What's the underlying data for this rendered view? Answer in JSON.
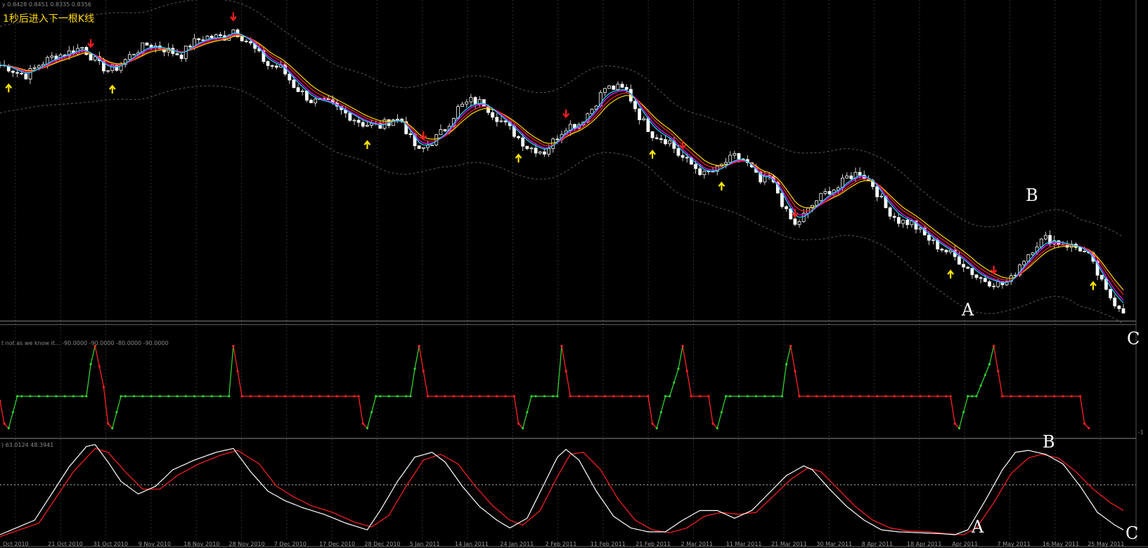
{
  "banner": "1秒后进入下一根K线",
  "price_header": "y  0.8428 0.8451 0.8335 0.8356",
  "indicator1_header": "t not as we know it...  -90.0000 -90.0000 -80.0000 -90.0000",
  "indicator2_header": ")  63.0124  48.3941",
  "panel2_scale_top": "",
  "panel2_scale_bottom": "-1",
  "letters": {
    "main_A": "A",
    "main_B": "B",
    "main_C": "C",
    "sub_A": "A",
    "sub_B": "B",
    "sub_C": "C"
  },
  "colors": {
    "background": "#000000",
    "bull_candle": "#ffffff",
    "bear_candle": "#ffffff",
    "ma_fast": "#ff00ff",
    "ma_medium": "#00e5ff",
    "ma_slow": "#ffd800",
    "ma_red": "#ff2020",
    "arrow_down": "#ff1e1e",
    "arrow_up": "#ffe600",
    "envelope": "#5a5a5a",
    "osc_up": "#30d030",
    "osc_down": "#ff2020",
    "stoch_main": "#ffffff",
    "stoch_signal": "#ff2020"
  },
  "chart_data": {
    "type": "candlestick",
    "x_ticks": [
      "Oct 2010",
      "21 Oct 2010",
      "31 Oct 2010",
      "9 Nov 2010",
      "18 Nov 2010",
      "28 Nov 2010",
      "7 Dec 2010",
      "17 Dec 2010",
      "28 Dec 2010",
      "5 Jan 2011",
      "14 Jan 2011",
      "24 Jan 2011",
      "2 Feb 2011",
      "11 Feb 2011",
      "21 Feb 2011",
      "2 Mar 2011",
      "11 Mar 2011",
      "21 Mar 2011",
      "30 Mar 2011",
      "8 Apr 2011",
      "18 Apr 2011",
      "Apr 2011",
      "7 May 2011",
      "16 May 2011",
      "25 May 2011"
    ],
    "price_anchors": [
      [
        0,
        0.8
      ],
      [
        2,
        0.79
      ],
      [
        4,
        0.77
      ],
      [
        6,
        0.76
      ],
      [
        9,
        0.8
      ],
      [
        12,
        0.83
      ],
      [
        16,
        0.85
      ],
      [
        19,
        0.87
      ],
      [
        21,
        0.835
      ],
      [
        23,
        0.8
      ],
      [
        25,
        0.78
      ],
      [
        27,
        0.79
      ],
      [
        31,
        0.85
      ],
      [
        34,
        0.88
      ],
      [
        37,
        0.87
      ],
      [
        40,
        0.85
      ],
      [
        42,
        0.84
      ],
      [
        44,
        0.88
      ],
      [
        46,
        0.9
      ],
      [
        48,
        0.91
      ],
      [
        52,
        0.91
      ],
      [
        54,
        0.94
      ],
      [
        58,
        0.88
      ],
      [
        62,
        0.8
      ],
      [
        65,
        0.79
      ],
      [
        68,
        0.72
      ],
      [
        72,
        0.66
      ],
      [
        76,
        0.65
      ],
      [
        80,
        0.61
      ],
      [
        84,
        0.57
      ],
      [
        88,
        0.56
      ],
      [
        91,
        0.59
      ],
      [
        93,
        0.58
      ],
      [
        95,
        0.51
      ],
      [
        97,
        0.46
      ],
      [
        100,
        0.5
      ],
      [
        103,
        0.55
      ],
      [
        106,
        0.63
      ],
      [
        109,
        0.66
      ],
      [
        112,
        0.65
      ],
      [
        114,
        0.61
      ],
      [
        118,
        0.55
      ],
      [
        122,
        0.48
      ],
      [
        126,
        0.46
      ],
      [
        128,
        0.5
      ],
      [
        131,
        0.56
      ],
      [
        134,
        0.57
      ],
      [
        137,
        0.63
      ],
      [
        140,
        0.71
      ],
      [
        143,
        0.71
      ],
      [
        145,
        0.7
      ],
      [
        148,
        0.6
      ],
      [
        151,
        0.53
      ],
      [
        155,
        0.5
      ],
      [
        157,
        0.45
      ],
      [
        160,
        0.41
      ],
      [
        163,
        0.37
      ],
      [
        166,
        0.39
      ],
      [
        168,
        0.42
      ],
      [
        170,
        0.44
      ],
      [
        172,
        0.43
      ],
      [
        174,
        0.39
      ],
      [
        176,
        0.34
      ],
      [
        178,
        0.36
      ],
      [
        180,
        0.3
      ],
      [
        182,
        0.22
      ],
      [
        184,
        0.17
      ],
      [
        186,
        0.21
      ],
      [
        189,
        0.27
      ],
      [
        192,
        0.31
      ],
      [
        194,
        0.32
      ],
      [
        196,
        0.36
      ],
      [
        199,
        0.38
      ],
      [
        202,
        0.33
      ],
      [
        205,
        0.24
      ],
      [
        208,
        0.19
      ],
      [
        211,
        0.18
      ],
      [
        214,
        0.13
      ],
      [
        217,
        0.09
      ],
      [
        220,
        0.06
      ],
      [
        223,
        0.02
      ],
      [
        226,
        -0.03
      ],
      [
        229,
        -0.05
      ],
      [
        232,
        -0.06
      ],
      [
        234,
        -0.04
      ],
      [
        236,
        0.02
      ],
      [
        238,
        0.06
      ],
      [
        240,
        0.1
      ],
      [
        242,
        0.12
      ],
      [
        244,
        0.11
      ],
      [
        246,
        0.1
      ],
      [
        248,
        0.09
      ],
      [
        250,
        0.08
      ],
      [
        252,
        0.05
      ],
      [
        254,
        -0.02
      ],
      [
        256,
        -0.09
      ],
      [
        258,
        -0.13
      ],
      [
        260,
        -0.16
      ]
    ],
    "bar_count": 261,
    "price_min": -0.19,
    "price_max": 1.0,
    "down_arrows": [
      21,
      54,
      98,
      131,
      158,
      184,
      230
    ],
    "up_arrows": [
      2,
      26,
      85,
      120,
      151,
      167,
      220,
      253
    ],
    "osc_bars": [
      [
        0,
        -30
      ],
      [
        1,
        -80
      ],
      [
        2,
        -90
      ],
      [
        4,
        -20
      ],
      [
        5,
        -20
      ],
      [
        20,
        -20
      ],
      [
        21,
        50
      ],
      [
        22,
        90
      ],
      [
        24,
        0
      ],
      [
        25,
        -80
      ],
      [
        26,
        -90
      ],
      [
        28,
        -20
      ],
      [
        29,
        -20
      ],
      [
        53,
        -20
      ],
      [
        54,
        90
      ],
      [
        56,
        -20
      ],
      [
        83,
        -20
      ],
      [
        84,
        -80
      ],
      [
        85,
        -90
      ],
      [
        87,
        -20
      ],
      [
        88,
        -20
      ],
      [
        95,
        -20
      ],
      [
        96,
        40
      ],
      [
        97,
        90
      ],
      [
        99,
        -20
      ],
      [
        119,
        -20
      ],
      [
        120,
        -80
      ],
      [
        121,
        -90
      ],
      [
        123,
        -20
      ],
      [
        124,
        -20
      ],
      [
        129,
        -20
      ],
      [
        130,
        90
      ],
      [
        132,
        -20
      ],
      [
        150,
        -20
      ],
      [
        151,
        -80
      ],
      [
        152,
        -90
      ],
      [
        154,
        -20
      ],
      [
        155,
        -20
      ],
      [
        157,
        40
      ],
      [
        158,
        90
      ],
      [
        160,
        -20
      ],
      [
        164,
        -20
      ],
      [
        165,
        -80
      ],
      [
        166,
        -90
      ],
      [
        168,
        -20
      ],
      [
        169,
        -20
      ],
      [
        181,
        -20
      ],
      [
        182,
        50
      ],
      [
        183,
        90
      ],
      [
        185,
        -20
      ],
      [
        220,
        -20
      ],
      [
        221,
        -80
      ],
      [
        222,
        -90
      ],
      [
        224,
        -20
      ],
      [
        225,
        -20
      ],
      [
        226,
        -20
      ],
      [
        229,
        50
      ],
      [
        230,
        90
      ],
      [
        232,
        -20
      ],
      [
        250,
        -20
      ],
      [
        251,
        -80
      ],
      [
        252,
        -90
      ]
    ],
    "stoch_main": [
      [
        0,
        5
      ],
      [
        8,
        20
      ],
      [
        16,
        75
      ],
      [
        20,
        96
      ],
      [
        22,
        98
      ],
      [
        25,
        80
      ],
      [
        28,
        60
      ],
      [
        32,
        47
      ],
      [
        36,
        55
      ],
      [
        40,
        72
      ],
      [
        45,
        82
      ],
      [
        50,
        90
      ],
      [
        54,
        94
      ],
      [
        58,
        70
      ],
      [
        62,
        50
      ],
      [
        66,
        40
      ],
      [
        70,
        33
      ],
      [
        75,
        26
      ],
      [
        80,
        17
      ],
      [
        85,
        10
      ],
      [
        88,
        30
      ],
      [
        92,
        60
      ],
      [
        96,
        85
      ],
      [
        100,
        90
      ],
      [
        103,
        80
      ],
      [
        107,
        55
      ],
      [
        111,
        34
      ],
      [
        115,
        20
      ],
      [
        118,
        12
      ],
      [
        122,
        22
      ],
      [
        126,
        58
      ],
      [
        129,
        85
      ],
      [
        131,
        93
      ],
      [
        134,
        82
      ],
      [
        138,
        50
      ],
      [
        142,
        24
      ],
      [
        146,
        12
      ],
      [
        150,
        8
      ],
      [
        154,
        8
      ],
      [
        158,
        20
      ],
      [
        162,
        30
      ],
      [
        166,
        30
      ],
      [
        170,
        22
      ],
      [
        174,
        30
      ],
      [
        178,
        48
      ],
      [
        182,
        66
      ],
      [
        186,
        76
      ],
      [
        188,
        72
      ],
      [
        192,
        52
      ],
      [
        196,
        34
      ],
      [
        200,
        20
      ],
      [
        204,
        10
      ],
      [
        208,
        8
      ],
      [
        213,
        7
      ],
      [
        218,
        6
      ],
      [
        221,
        5
      ],
      [
        224,
        10
      ],
      [
        228,
        40
      ],
      [
        232,
        72
      ],
      [
        235,
        90
      ],
      [
        238,
        92
      ],
      [
        242,
        88
      ],
      [
        246,
        78
      ],
      [
        250,
        55
      ],
      [
        254,
        28
      ],
      [
        258,
        15
      ],
      [
        260,
        10
      ]
    ],
    "stoch_signal": [
      [
        0,
        3
      ],
      [
        9,
        17
      ],
      [
        17,
        70
      ],
      [
        22,
        94
      ],
      [
        25,
        90
      ],
      [
        29,
        70
      ],
      [
        33,
        52
      ],
      [
        37,
        52
      ],
      [
        41,
        66
      ],
      [
        46,
        78
      ],
      [
        51,
        87
      ],
      [
        55,
        92
      ],
      [
        60,
        78
      ],
      [
        64,
        55
      ],
      [
        68,
        44
      ],
      [
        72,
        35
      ],
      [
        77,
        28
      ],
      [
        82,
        18
      ],
      [
        86,
        13
      ],
      [
        90,
        25
      ],
      [
        94,
        55
      ],
      [
        98,
        82
      ],
      [
        102,
        88
      ],
      [
        106,
        78
      ],
      [
        110,
        55
      ],
      [
        114,
        35
      ],
      [
        118,
        20
      ],
      [
        121,
        15
      ],
      [
        125,
        30
      ],
      [
        129,
        65
      ],
      [
        132,
        88
      ],
      [
        135,
        90
      ],
      [
        139,
        72
      ],
      [
        143,
        42
      ],
      [
        147,
        20
      ],
      [
        151,
        10
      ],
      [
        155,
        7
      ],
      [
        159,
        12
      ],
      [
        163,
        24
      ],
      [
        167,
        28
      ],
      [
        171,
        26
      ],
      [
        175,
        28
      ],
      [
        179,
        45
      ],
      [
        183,
        62
      ],
      [
        187,
        74
      ],
      [
        190,
        70
      ],
      [
        194,
        52
      ],
      [
        198,
        34
      ],
      [
        202,
        20
      ],
      [
        206,
        12
      ],
      [
        210,
        9
      ],
      [
        215,
        8
      ],
      [
        219,
        6
      ],
      [
        223,
        5
      ],
      [
        226,
        12
      ],
      [
        230,
        38
      ],
      [
        234,
        68
      ],
      [
        238,
        84
      ],
      [
        241,
        88
      ],
      [
        245,
        84
      ],
      [
        249,
        70
      ],
      [
        253,
        52
      ],
      [
        257,
        38
      ],
      [
        260,
        30
      ]
    ]
  }
}
